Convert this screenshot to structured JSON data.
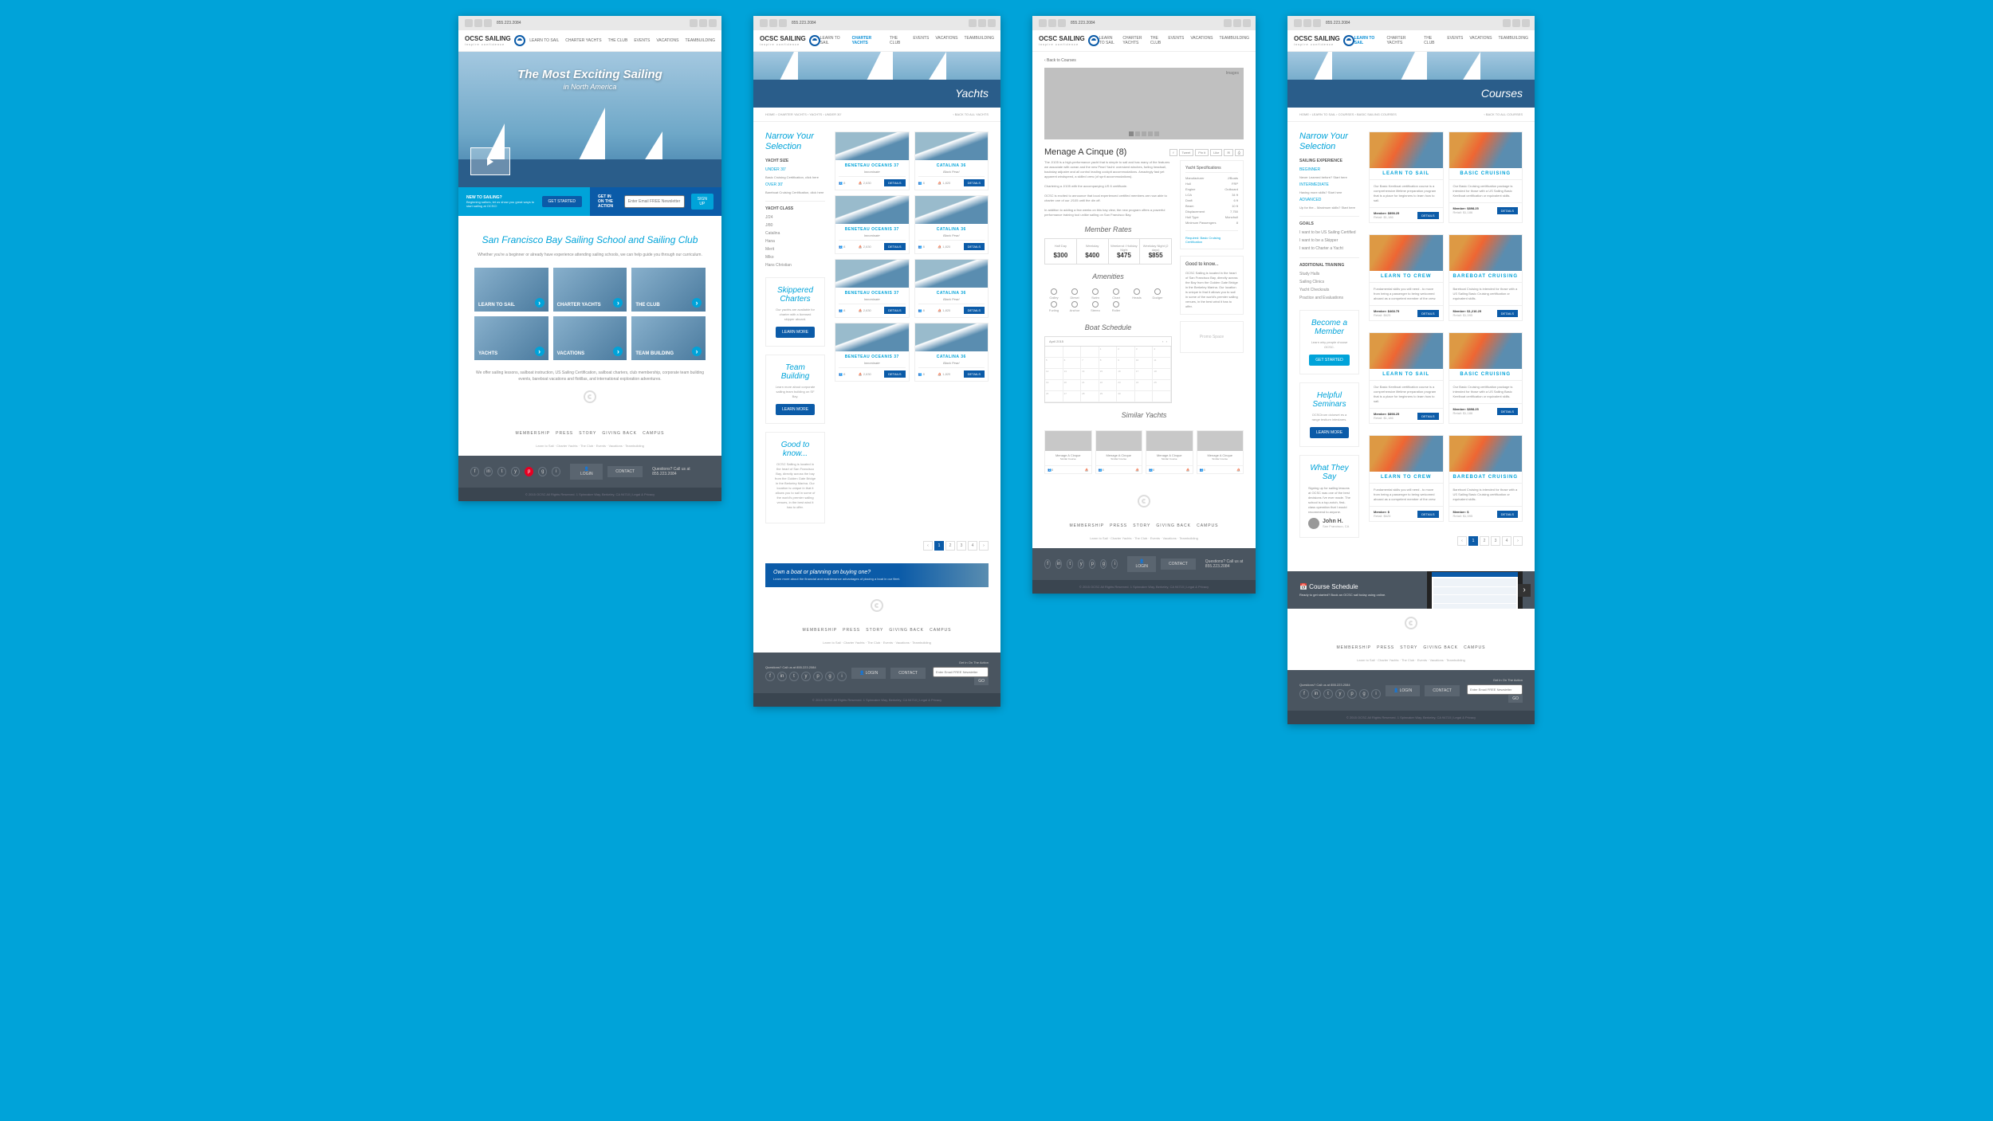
{
  "topbar": {
    "phone": "855.223.2084"
  },
  "logo": {
    "name": "OCSC SAILING",
    "tagline": "inspire confidence"
  },
  "nav": [
    "LEARN TO SAIL",
    "CHARTER YACHTS",
    "THE CLUB",
    "EVENTS",
    "VACATIONS",
    "TEAMBUILDING"
  ],
  "home": {
    "hero_title": "The Most Exciting Sailing",
    "hero_sub": "in North America",
    "cta1": {
      "h": "NEW TO SAILING?",
      "p": "Beginning sailors, let us show you great ways to start sailing at OCSC!",
      "btn": "GET STARTED"
    },
    "cta2": {
      "h": "GET IN ON THE ACTION",
      "placeholder": "Enter Email FREE Newsletter",
      "btn": "SIGN UP"
    },
    "h2": "San Francisco Bay Sailing School and Sailing Club",
    "intro": "Whether you're a beginner or already have experience attending sailing schools, we can help guide you through our curriculum.",
    "tiles": [
      "LEARN TO SAIL",
      "CHARTER YACHTS",
      "THE CLUB",
      "YACHTS",
      "VACATIONS",
      "TEAM BUILDING"
    ],
    "outro": "We offer sailing lessons, sailboat instruction, US Sailing Certification, sailboat charters, club membership, corporate team building events, bareboat vacations and flotillas, and international exploration adventures."
  },
  "yachts": {
    "hero": "Yachts",
    "bc": [
      "HOME",
      "CHARTER YACHTS",
      "YACHTS",
      "UNDER 30'"
    ],
    "bc_back": "‹ BACK TO ALL YACHTS",
    "filter_h": "Narrow Your Selection",
    "size_lbl": "YACHT SIZE",
    "size_opts": [
      "UNDER 30'",
      "Basic Cruising Certification, click here",
      "OVER 30'",
      "Bareboat Cruising Certification, click here"
    ],
    "class_lbl": "YACHT CLASS",
    "class_opts": [
      "J/24",
      "J/80",
      "Catalina",
      "Hana",
      "Merit",
      "Miko",
      "Hans Christian"
    ],
    "cards": [
      {
        "title": "BENETEAU OCEANIS 37",
        "sub": "Innominate",
        "crew": "8",
        "sail": "2,630"
      },
      {
        "title": "CATALINA 36",
        "sub": "Black Pearl",
        "crew": "8",
        "sail": "1,820"
      },
      {
        "title": "BENETEAU OCEANIS 37",
        "sub": "Innominate",
        "crew": "8",
        "sail": "2,630"
      },
      {
        "title": "CATALINA 36",
        "sub": "Black Pearl",
        "crew": "8",
        "sail": "1,820"
      },
      {
        "title": "BENETEAU OCEANIS 37",
        "sub": "Innominate",
        "crew": "8",
        "sail": "2,630"
      },
      {
        "title": "CATALINA 36",
        "sub": "Black Pearl",
        "crew": "8",
        "sail": "1,820"
      },
      {
        "title": "BENETEAU OCEANIS 37",
        "sub": "Innominate",
        "crew": "8",
        "sail": "2,630"
      },
      {
        "title": "CATALINA 36",
        "sub": "Black Pearl",
        "crew": "8",
        "sail": "1,820"
      }
    ],
    "details": "DETAILS",
    "promos": [
      {
        "h": "Skippered Charters",
        "p": "Our yachts are available for charter with a licensed skipper aboard.",
        "btn": "LEARN MORE"
      },
      {
        "h": "Team Building",
        "p": "Learn more about corporate sailing team building on SF Bay.",
        "btn": "LEARN MORE"
      },
      {
        "h": "Good to know...",
        "p": "OCSC Sailing is located in the heart of San Francisco Bay, directly across the bay from the Golden Gate Bridge in the Berkeley Marina. Our location is unique in that it allows you to sail in some of the world's premier sailing venues, in the best wind it has to offer."
      }
    ],
    "pager": [
      "‹",
      "1",
      "2",
      "3",
      "4",
      "›"
    ],
    "banner": {
      "h": "Own a boat or planning on buying one?",
      "p": "Learn more about the financial and maintenance advantages of placing a boat in our fleet."
    }
  },
  "detail": {
    "back": "‹ Back to Courses",
    "hero_lbl": "Images",
    "title": "Menage A Cinque (8)",
    "share": [
      "f",
      "Tweet",
      "Pin it",
      "Like",
      "✉",
      "⎙"
    ],
    "desc1": "The J/105 is a high-performance yacht that is simple to sail and has many of the features we associate with ocean and the new Pearl Yacht: oversized winches, furling headsail, backstay adjuster and all control leading cockpit accommodations. Amazingly fast yet apparent windspeed, a skilled crew (of sprit accommodations).",
    "desc2": "Chartering a J/105 with the accompanying US 6 certificate.",
    "desc3": "OCSC is excited to announce that local experienced certified members are now able to charter one of our J/105 until the din off.",
    "desc4": "In addition to adding a few weeks on this bay view, the new program offers a powerful performance training tool unlike sailing on San Francisco Bay.",
    "rates_h": "Member Rates",
    "rates": [
      {
        "l": "Half Day",
        "v": "$300"
      },
      {
        "l": "Weekday",
        "v": "$400"
      },
      {
        "l": "Weekend / Holiday Night",
        "v": "$475"
      },
      {
        "l": "Weekday Night (2 days)",
        "v": "$855"
      }
    ],
    "amen_h": "Amenities",
    "amens": [
      "Galley",
      "Diesel",
      "Swim",
      "Chart",
      "Heads",
      "Dodger",
      "Furling",
      "Anchor",
      "Stereo",
      "Roller"
    ],
    "sched_h": "Boat Schedule",
    "cal_month": "April 2015",
    "specs_h": "Yacht Specifications",
    "specs": [
      [
        "Manufacturer",
        "J/Boats"
      ],
      [
        "Hull",
        "FRP"
      ],
      [
        "Engine",
        "Outboard"
      ],
      [
        "LOA",
        "34 ft"
      ],
      [
        "Draft",
        "6 ft"
      ],
      [
        "Beam",
        "10 ft"
      ],
      [
        "Displacement",
        "7,750"
      ],
      [
        "Hull Type",
        "Monohull"
      ],
      [
        "Minimum Passengers",
        "8"
      ]
    ],
    "req": "Required: Basic Cruising Certification",
    "gtk_h": "Good to know...",
    "gtk": "OCSC Sailing is located in the heart of San Francisco Bay, directly across the Bay from the Golden Gate Bridge in the Berkeley Marina. Our location is unique in that it allows you to sail in some of the world's premier sailing venues, in the best wind it has to offer.",
    "promo": "Promo Space",
    "sim_h": "Similar Yachts",
    "sims": [
      {
        "t": "Menage A Cinque",
        "s": "Similar Course"
      },
      {
        "t": "Menage A Cinque",
        "s": "Similar Course"
      },
      {
        "t": "Menage A Cinque",
        "s": "Similar Course"
      },
      {
        "t": "Menage A Cinque",
        "s": "Similar Course"
      }
    ]
  },
  "courses": {
    "hero": "Courses",
    "bc": [
      "HOME",
      "LEARN TO SAIL",
      "COURSES",
      "BASIC SAILING COURSES"
    ],
    "bc_back": "‹ BACK TO ALL COURSES",
    "filter_h": "Narrow Your Selection",
    "f1_lbl": "SAILING EXPERIENCE",
    "f1": [
      "BEGINNER",
      "Never Learned before? Start here",
      "INTERMEDIATE",
      "Having more skills? Start here",
      "ADVANCED",
      "Up for the... Maximum skills? Start here"
    ],
    "f2_lbl": "GOALS",
    "f2": [
      "I want to be US Sailing Certified",
      "I want to be a Skipper",
      "I want to Charter a Yacht"
    ],
    "f3_lbl": "ADDITIONAL TRAINING",
    "f3": [
      "Study Halls",
      "Sailing Clinics",
      "Yacht Checkouts",
      "Practice and Evaluations"
    ],
    "cards": [
      {
        "h": "LEARN TO SAIL",
        "p": "Our Basic Keelboat certification course is a comprehensive lifetime preparation program that is a place for beginners to learn how to sail.",
        "m": "Member: $898.25",
        "r": "Retail: $1,186"
      },
      {
        "h": "BASIC CRUISING",
        "p": "Our Basic Cruising certification package is intended for those with a US Sailing Basic Keelboat certification or equivalent skills.",
        "m": "Member: $898.25",
        "r": "Retail: $1,186"
      },
      {
        "h": "LEARN TO CREW",
        "p": "Fundamental skills you will need - to move from being a passenger to being welcomed aboard as a competent member of the crew.",
        "m": "Member: $468.75",
        "r": "Retail: $625"
      },
      {
        "h": "BAREBOAT CRUISING",
        "p": "Bareboat Cruising is intended for those with a US Sailing Basic Cruising certification or equivalent skills.",
        "m": "Member: $1,216.25",
        "r": "Retail: $1,595"
      },
      {
        "h": "LEARN TO SAIL",
        "p": "Our Basic Keelboat certification course is a comprehensive lifetime preparation program that is a place for beginners to learn how to sail.",
        "m": "Member: $898.25",
        "r": "Retail: $1,186"
      },
      {
        "h": "BASIC CRUISING",
        "p": "Our Basic Cruising certification package is intended for those with a US Sailing Basic Keelboat certification or equivalent skills.",
        "m": "Member: $898.25",
        "r": "Retail: $1,186"
      },
      {
        "h": "LEARN TO CREW",
        "p": "Fundamental skills you will need - to move from being a passenger to being welcomed aboard as a competent member of the crew.",
        "m": "Member: $",
        "r": "Retail: $625"
      },
      {
        "h": "BAREBOAT CRUISING",
        "p": "Bareboat Cruising is intended for those with a US Sailing Basic Cruising certification or equivalent skills.",
        "m": "Member: $",
        "r": "Retail: $1,595"
      }
    ],
    "promos": [
      {
        "h": "Become a Member",
        "p": "Learn why people choose OCSC.",
        "btn": "GET STARTED"
      },
      {
        "h": "Helpful Seminars",
        "p": "OCSCtrum dolorset es a range testium intestares.",
        "btn": "LEARN MORE"
      },
      {
        "h": "What They Say",
        "p": "Signing up for sailing lessons at OCSC was one of the best decisions I've ever made. The school is a top-notch, first-class operation that I would recommend to anyone.",
        "who": "John H.",
        "loc": "San Francisco, CA"
      }
    ],
    "sched": {
      "h": "📅 Course Schedule",
      "p": "Ready to get started? Book an OCSC sail today using online."
    }
  },
  "footer": {
    "nav": [
      "MEMBERSHIP",
      "PRESS",
      "STORY",
      "GIVING BACK",
      "CAMPUS"
    ],
    "nav2": [
      "Learn to Sail",
      "Charter Yachts",
      "The Club",
      "Events",
      "Vacations",
      "Teambuilding"
    ],
    "login": "LOGIN",
    "contact": "CONTACT",
    "q": "Questions? Call us at 855.223.2084",
    "copy": "© 2015 OCSC All Rights Reserved. 1 Spinnaker Way, Berkeley, CA 94710  |  Legal & Privacy",
    "news_lbl": "Get In On The Action",
    "news_ph": "Enter Email FREE Newsletter",
    "news_btn": "GO"
  }
}
